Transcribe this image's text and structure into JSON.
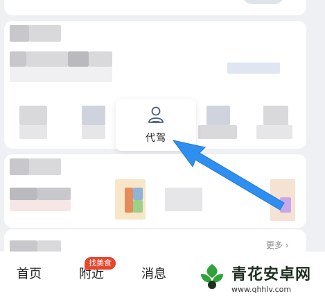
{
  "service": {
    "label": "代驾",
    "icon": "driver-icon"
  },
  "section": {
    "more_label": "更多 ›"
  },
  "tabbar": {
    "home": "首页",
    "nearby": "附近",
    "nearby_badge": "找美食",
    "messages": "消息"
  },
  "watermark": {
    "title": "青花安卓网",
    "url": "www.qhhlv.com"
  },
  "colors": {
    "arrow": "#2f8ff0",
    "badge": "#e8452c",
    "watermark_green": "#2fa33a"
  }
}
